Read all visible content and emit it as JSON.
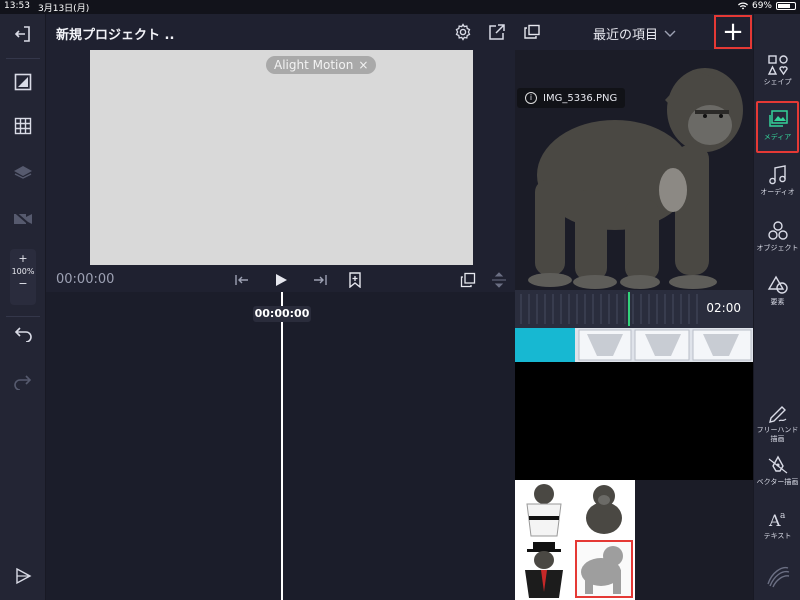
{
  "status_bar": {
    "time": "13:53",
    "date": "3月13日(月)",
    "battery": "69%"
  },
  "header": {
    "project_title": "新規プロジェクト .."
  },
  "left_toolbar": {
    "zoom_plus": "+",
    "zoom_level": "100%",
    "zoom_minus": "−"
  },
  "preview": {
    "watermark": "Alight Motion",
    "watermark_close": "×"
  },
  "transport": {
    "timecode": "00:00:00"
  },
  "timeline": {
    "playhead_time": "00:00:00"
  },
  "media_panel": {
    "dropdown_label": "最近の項目",
    "add_label": "+",
    "file_name": "IMG_5336.PNG",
    "duration": "02:00"
  },
  "right_toolbar": {
    "items": [
      {
        "label": "シェイプ",
        "icon": "shapes-icon"
      },
      {
        "label": "メディア",
        "icon": "media-icon",
        "active": true
      },
      {
        "label": "オーディオ",
        "icon": "music-icon"
      },
      {
        "label": "オブジェクト",
        "icon": "objects-icon"
      },
      {
        "label": "要素",
        "icon": "elements-icon"
      },
      {
        "label": "フリーハンド描画",
        "icon": "freehand-pen-icon"
      },
      {
        "label": "ベクター描画",
        "icon": "vector-pen-icon"
      },
      {
        "label": "テキスト",
        "icon": "text-icon"
      }
    ]
  },
  "colors": {
    "accent_green": "#34d399",
    "highlight_red": "#e53935",
    "panel_bg": "#1f2130"
  }
}
